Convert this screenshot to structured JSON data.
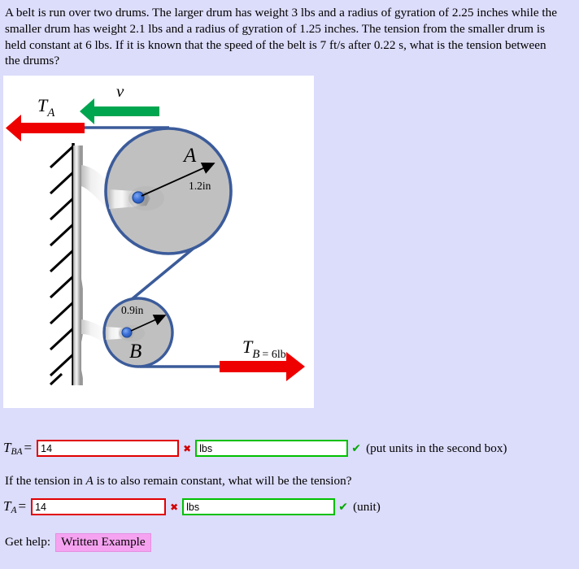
{
  "problem": {
    "statement": "A belt is run over two drums. The larger drum has weight 3 lbs and a radius of gyration of 2.25 inches while the smaller drum has weight 2.1 lbs and a radius of gyration of 1.25 inches. The tension from the smaller drum is held constant at 6 lbs. If it is known that the speed of the belt is 7 ft/s after 0.22 s, what is the tension between the drums?"
  },
  "figure": {
    "label_v": "v",
    "label_TA": "T",
    "label_TA_sub": "A",
    "label_A": "A",
    "label_B": "B",
    "radius_A": "1.2in",
    "radius_B": "0.9in",
    "label_TB": "T",
    "label_TB_sub": "B",
    "label_TB_value": "= 6lb",
    "colors": {
      "belt": "#3b5b9a",
      "drum_fill": "#c0c0c0",
      "tension_arrow": "#ee0000",
      "velocity_arrow": "#00a550",
      "hub": "#3a6fd8",
      "panel_bg": "#ffffff"
    }
  },
  "answers": {
    "row1": {
      "label_main": "T",
      "label_sub": "BA",
      "equals": "=",
      "value": "14",
      "value_placeholder": "",
      "value_status": "incorrect",
      "value_mark": "✖",
      "unit": "lbs",
      "unit_placeholder": "",
      "unit_status": "correct",
      "unit_mark": "✔",
      "hint": "(put units in the second box)"
    },
    "row2": {
      "label_main": "T",
      "label_sub": "A",
      "equals": "=",
      "value": "14",
      "value_placeholder": "",
      "value_status": "incorrect",
      "value_mark": "✖",
      "unit": "lbs",
      "unit_placeholder": "",
      "unit_status": "correct",
      "unit_mark": "✔",
      "hint": "(unit)"
    }
  },
  "mid_question": {
    "part1": "If the tension in ",
    "emphasis": "A",
    "part2": " is to also remain constant, what will be the tension?"
  },
  "help": {
    "label": "Get help:",
    "button_label": "Written Example"
  },
  "theme": {
    "page_bg": "#dcdcfb",
    "incorrect_border": "#e00000",
    "correct_border": "#00c000",
    "help_button_bg": "#f5a3f0"
  }
}
